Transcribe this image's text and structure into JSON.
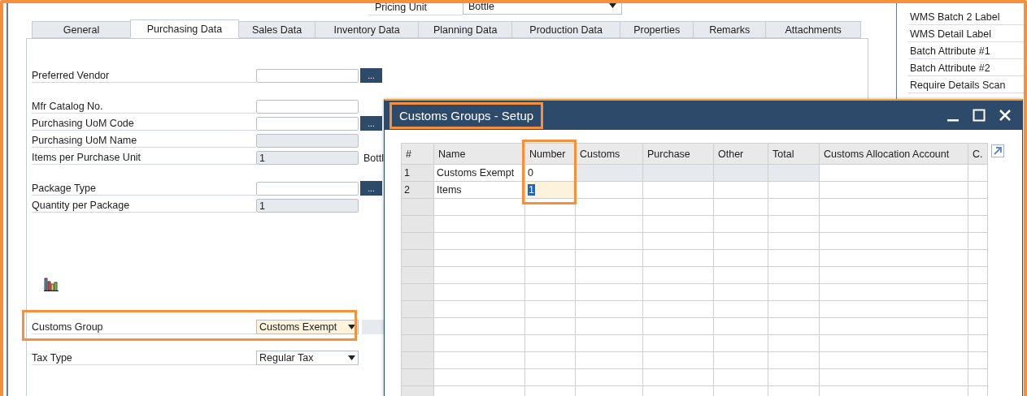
{
  "header_field": {
    "label": "Pricing Unit",
    "value": "Bottle"
  },
  "tabs": [
    {
      "label": "General",
      "selected": false
    },
    {
      "label": "Purchasing Data",
      "selected": true
    },
    {
      "label": "Sales Data",
      "selected": false
    },
    {
      "label": "Inventory Data",
      "selected": false
    },
    {
      "label": "Planning Data",
      "selected": false
    },
    {
      "label": "Production Data",
      "selected": false
    },
    {
      "label": "Properties",
      "selected": false
    },
    {
      "label": "Remarks",
      "selected": false
    },
    {
      "label": "Attachments",
      "selected": false
    }
  ],
  "field_groups": [
    [
      {
        "label": "Preferred Vendor",
        "kind": "lookup",
        "button": "..."
      }
    ],
    [
      {
        "label": "Mfr Catalog No.",
        "kind": "text"
      },
      {
        "label": "Purchasing UoM Code",
        "kind": "lookup",
        "button": "..."
      },
      {
        "label": "Purchasing UoM Name",
        "kind": "readonly"
      },
      {
        "label": "Items per Purchase Unit",
        "kind": "readonly",
        "value": "1",
        "suffix": "Bottl"
      }
    ],
    [
      {
        "label": "Package Type",
        "kind": "lookup",
        "button": "..."
      },
      {
        "label": "Quantity per Package",
        "kind": "readonly",
        "value": "1"
      }
    ],
    [
      {
        "kind": "chart-button"
      }
    ],
    [
      {
        "label": "Customs Group",
        "kind": "select",
        "value": "Customs Exempt",
        "focused": true,
        "highlighted": true
      }
    ],
    [
      {
        "label": "Tax Type",
        "kind": "select",
        "value": "Regular Tax",
        "focused": false,
        "highlighted": false
      }
    ]
  ],
  "side_list": [
    "WMS Batch 2 Label",
    "WMS Detail Label",
    "Batch Attribute #1",
    "Batch Attribute #2",
    "Require Details Scan"
  ],
  "dialog": {
    "title": "Customs Groups - Setup",
    "title_highlighted": true,
    "columns": [
      {
        "label": "#",
        "highlighted": false
      },
      {
        "label": "Name",
        "highlighted": false
      },
      {
        "label": "Number",
        "highlighted": true
      },
      {
        "label": "Customs",
        "highlighted": false
      },
      {
        "label": "Purchase",
        "highlighted": false
      },
      {
        "label": "Other",
        "highlighted": false
      },
      {
        "label": "Total",
        "highlighted": false
      },
      {
        "label": "Customs Allocation Account",
        "highlighted": false
      },
      {
        "label": "C.",
        "highlighted": false
      }
    ],
    "rows": [
      {
        "cells": [
          "1",
          "Customs Exempt",
          "0",
          "",
          "",
          "",
          "",
          "",
          ""
        ],
        "locked": true,
        "editing": false
      },
      {
        "cells": [
          "2",
          "Items",
          "1",
          "",
          "",
          "",
          "",
          "",
          ""
        ],
        "locked": false,
        "editing": true
      }
    ]
  }
}
